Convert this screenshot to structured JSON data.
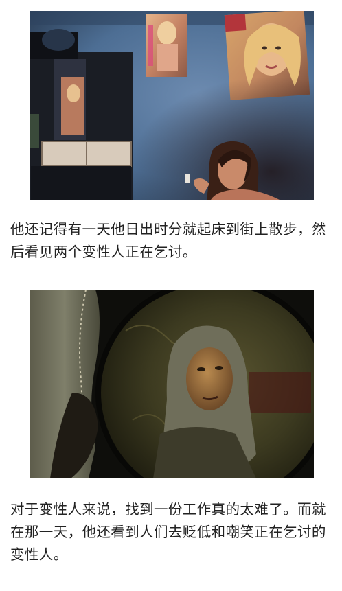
{
  "article": {
    "images": [
      {
        "icon": "photo-woman-applying-makeup-under-posters",
        "colors": {
          "wall": "#4d6e94",
          "cabinet": "#1a1d24",
          "skin": "#c98a6a"
        }
      },
      {
        "icon": "photo-veiled-woman-reflected-in-mirror",
        "colors": {
          "background": "#0e0e0b",
          "mirror": "#3c3a20",
          "scarf": "#7f7f6a"
        }
      }
    ],
    "paragraphs": [
      "他还记得有一天他日出时分就起床到街上散步，然后看见两个变性人正在乞讨。",
      "对于变性人来说，找到一份工作真的太难了。而就在那一天，他还看到人们去贬低和嘲笑正在乞讨的变性人。"
    ]
  }
}
